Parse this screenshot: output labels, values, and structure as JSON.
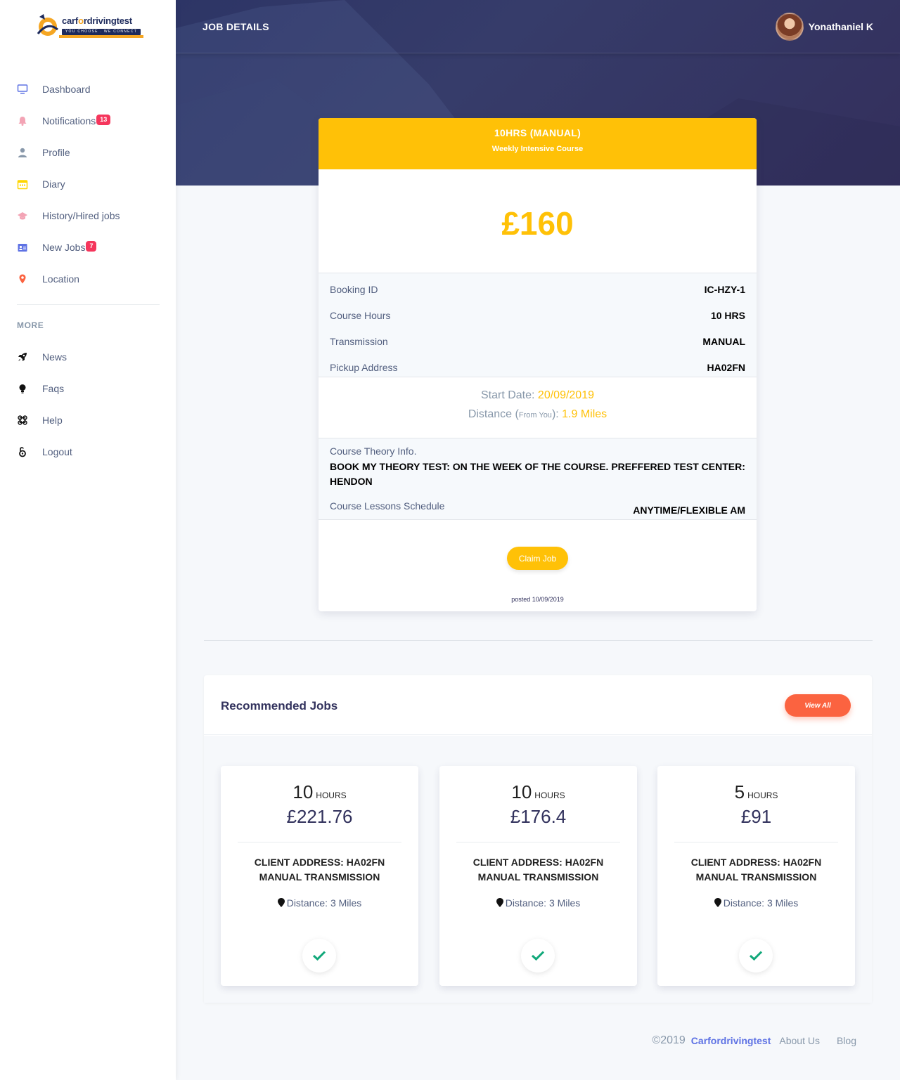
{
  "brand": {
    "name_pre": "carf",
    "name_o": "o",
    "name_post": "rdrivingtest",
    "tagline": "YOU CHOOSE . WE CONNECT"
  },
  "sidebar": {
    "items": [
      {
        "label": "Dashboard",
        "icon": "monitor-icon"
      },
      {
        "label": "Notifications",
        "icon": "bell-icon",
        "badge": "13"
      },
      {
        "label": "Profile",
        "icon": "user-icon"
      },
      {
        "label": "Diary",
        "icon": "calendar-icon"
      },
      {
        "label": "History/Hired jobs",
        "icon": "graduation-cap-icon"
      },
      {
        "label": "New Jobs",
        "icon": "id-badge-icon",
        "badge": "7"
      },
      {
        "label": "Location",
        "icon": "pin-icon"
      }
    ],
    "more_label": "MORE",
    "more_items": [
      {
        "label": "News",
        "icon": "rocket-icon"
      },
      {
        "label": "Faqs",
        "icon": "lightbulb-icon"
      },
      {
        "label": "Help",
        "icon": "command-icon"
      },
      {
        "label": "Logout",
        "icon": "lock-open-icon"
      }
    ]
  },
  "header": {
    "title": "JOB DETAILS",
    "user_name": "Yonathaniel K"
  },
  "job": {
    "title": "10HRS (MANUAL)",
    "subtitle": "Weekly Intensive Course",
    "price": "£160",
    "details": [
      {
        "key": "Booking ID",
        "value": "IC-HZY-1"
      },
      {
        "key": "Course Hours",
        "value": "10 HRS"
      },
      {
        "key": "Transmission",
        "value": "MANUAL"
      },
      {
        "key": "Pickup Address",
        "value": "HA02FN"
      }
    ],
    "start_date_label": "Start Date:",
    "start_date": "20/09/2019",
    "distance_label": "Distance",
    "distance_from": "From You",
    "distance": "1.9 Miles",
    "theory_label": "Course Theory Info.",
    "theory_value": "BOOK MY THEORY TEST: ON THE WEEK OF THE COURSE. PREFFERED TEST CENTER: HENDON",
    "schedule_label": "Course Lessons Schedule",
    "schedule_value": "ANYTIME/FLEXIBLE AM",
    "claim_label": "Claim Job",
    "posted": "posted 10/09/2019"
  },
  "recommended": {
    "title": "Recommended Jobs",
    "view_all": "View All",
    "jobs": [
      {
        "hours": "10",
        "hours_unit": "HOURS",
        "price": "£221.76",
        "address": "CLIENT ADDRESS: HA02FN",
        "transmission": "MANUAL TRANSMISSION",
        "distance": "Distance: 3 Miles"
      },
      {
        "hours": "10",
        "hours_unit": "HOURS",
        "price": "£176.4",
        "address": "CLIENT ADDRESS: HA02FN",
        "transmission": "MANUAL TRANSMISSION",
        "distance": "Distance: 3 Miles"
      },
      {
        "hours": "5",
        "hours_unit": "HOURS",
        "price": "£91",
        "address": "CLIENT ADDRESS: HA02FN",
        "transmission": "MANUAL TRANSMISSION",
        "distance": "Distance: 3 Miles"
      }
    ]
  },
  "footer": {
    "copyright": "©2019",
    "brand": "Carfordrivingtest",
    "about": "About Us",
    "blog": "Blog"
  },
  "colors": {
    "accent": "#ffc107",
    "orange": "#fb6340",
    "header_bg": "#2d3566",
    "badge": "#f5365c",
    "check": "#2dce89"
  }
}
